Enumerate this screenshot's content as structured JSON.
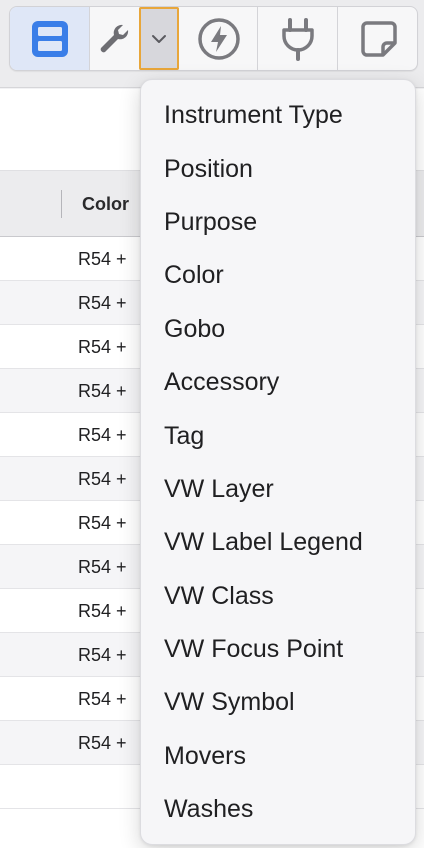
{
  "toolbar": {
    "accent_color": "#3a7ee8",
    "dropdown_highlight_color": "#e8a63a",
    "buttons": [
      {
        "icon": "layout-panels-icon",
        "active": true
      },
      {
        "icon": "wrench-icon",
        "active": false
      },
      {
        "icon": "chevron-down-icon",
        "active": false
      },
      {
        "icon": "lightning-icon",
        "active": false
      },
      {
        "icon": "plug-icon",
        "active": false
      },
      {
        "icon": "sticky-note-icon",
        "active": false
      }
    ]
  },
  "table": {
    "header": {
      "color_column": "Color"
    },
    "rows": [
      {
        "color": "R54 +"
      },
      {
        "color": "R54 +"
      },
      {
        "color": "R54 +"
      },
      {
        "color": "R54 +"
      },
      {
        "color": "R54 +"
      },
      {
        "color": "R54 +"
      },
      {
        "color": "R54 +"
      },
      {
        "color": "R54 +"
      },
      {
        "color": "R54 +"
      },
      {
        "color": "R54 +"
      },
      {
        "color": "R54 +"
      },
      {
        "color": "R54 +"
      },
      {
        "color": ""
      }
    ]
  },
  "menu": {
    "items": [
      "Instrument Type",
      "Position",
      "Purpose",
      "Color",
      "Gobo",
      "Accessory",
      "Tag",
      "VW Layer",
      "VW Label Legend",
      "VW Class",
      "VW Focus Point",
      "VW Symbol",
      "Movers",
      "Washes"
    ]
  }
}
